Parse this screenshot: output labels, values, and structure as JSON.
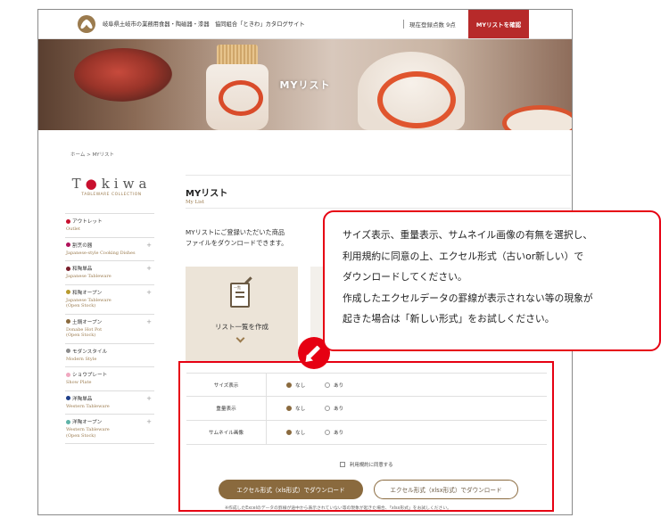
{
  "header": {
    "site_title": "岐阜県土岐市の業務用食器・陶磁器・漆器　協同組合「ときわ」カタログサイト",
    "count_prefix": "現在登録点数",
    "count_value": "9点",
    "mylist_button": "MYリストを確認"
  },
  "hero": {
    "title": "MYリスト"
  },
  "breadcrumb": "ホーム > MYリスト",
  "brand": {
    "name_part1": "T",
    "name_part2": "kiwa",
    "dot": "●",
    "sub": "TABLEWARE COLLECTION"
  },
  "sidebar": {
    "items": [
      {
        "jp": "アウトレット",
        "en": "Outlet",
        "color": "#c8102e",
        "expandable": false
      },
      {
        "jp": "割烹の器",
        "en": "Japanese-style Cooking Dishes",
        "color": "#b0125b",
        "expandable": true
      },
      {
        "jp": "和陶単品",
        "en": "Japanese Tableware",
        "color": "#7a1f2b",
        "expandable": true
      },
      {
        "jp": "和陶オープン",
        "en": "Japanese Tableware\n(Open Stock)",
        "color": "#b89a2e",
        "expandable": true
      },
      {
        "jp": "土鍋オープン",
        "en": "Donabe Hot Pot\n(Open Stock)",
        "color": "#8a6a3e",
        "expandable": true
      },
      {
        "jp": "モダンスタイル",
        "en": "Modern Style",
        "color": "#8c8c8c",
        "expandable": false
      },
      {
        "jp": "ショウプレート",
        "en": "Show Plate",
        "color": "#f0a8c0",
        "expandable": false
      },
      {
        "jp": "洋陶単品",
        "en": "Western Tableware",
        "color": "#1f3f8a",
        "expandable": true
      },
      {
        "jp": "洋陶オープン",
        "en": "Western Tableware\n(Open Stock)",
        "color": "#5fb3a8",
        "expandable": true
      }
    ]
  },
  "main": {
    "title": "MYリスト",
    "subtitle": "My List",
    "intro": "MYリストにご登録いただいた商品\nファイルをダウンロードできます。",
    "card_label": "リスト一覧を作成",
    "card_icon_text": "一覧"
  },
  "options": {
    "rows": [
      {
        "label": "サイズ表示",
        "opt1": "なし",
        "opt2": "あり",
        "selected": 1
      },
      {
        "label": "重量表示",
        "opt1": "なし",
        "opt2": "あり",
        "selected": 1
      },
      {
        "label": "サムネイル画像",
        "opt1": "なし",
        "opt2": "あり",
        "selected": 1
      }
    ],
    "agree_label": "利用規約に同意する",
    "btn_xls": "エクセル形式（xls形式）でダウンロード",
    "btn_xlsx": "エクセル形式（xlsx形式）でダウンロード",
    "note": "※作成したExcelのデータの罫線が途中から表示されていない等の現象が起きた場合、「xlsx形式」をお試しください。"
  },
  "callout": {
    "text": "サイズ表示、重量表示、サムネイル画像の有無を選択し、\n利用規約に同意の上、エクセル形式（古いor新しい）で\nダウンロードしてください。\n作成したエクセルデータの罫線が表示されない等の現象が\n起きた場合は「新しい形式」をお試しください。"
  },
  "colors": {
    "accent_red": "#e60012",
    "brand_red": "#b72a2a",
    "brown": "#8a6a3e"
  }
}
